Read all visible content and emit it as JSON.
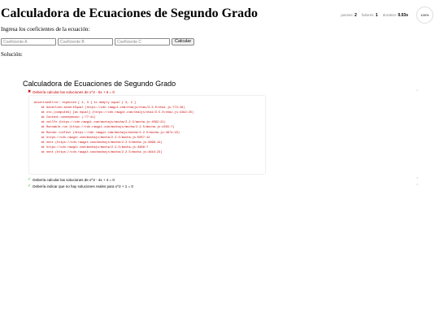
{
  "app": {
    "title": "Calculadora de Ecuaciones de Segundo Grado",
    "instructions": "Ingresa los coeficientes de la ecuación:",
    "inputs": [
      {
        "placeholder": "Coeficiente A",
        "value": ""
      },
      {
        "placeholder": "Coeficiente B",
        "value": ""
      },
      {
        "placeholder": "Coeficiente C",
        "value": ""
      }
    ],
    "calculate_label": "Calcular",
    "solution_label": "Solución:"
  },
  "stats": {
    "passes_label": "passes:",
    "passes": "2",
    "failures_label": "failures:",
    "failures": "1",
    "duration_label": "duration:",
    "duration": "0.03s",
    "progress": "100%"
  },
  "suite": {
    "title": "Calculadora de Ecuaciones de Segundo Grado",
    "tests": [
      {
        "status": "fail",
        "mark": "✖",
        "title": "Debería calcular las soluciones de x^2 - 5x + 6 = 0"
      },
      {
        "status": "pass",
        "mark": "✓",
        "title": "Debería calcular las soluciones de x^2 - 4x + 4 = 0"
      },
      {
        "status": "pass",
        "mark": "✓",
        "title": "Debería indicar que no hay soluciones reales para x^2 + 1 = 0"
      }
    ],
    "replay_glyph": "‣",
    "error_lines": [
      "AssertionError: expected [ 2, 3 ] to deeply equal [ 3, 2 ]",
      "    at Assertion.assertEqual (https://cdn.rawgit.com/chaijs/chai/3.5.0/chai.js:774:19)",
      "    at ctx.(computed) [as equal] (https://cdn.rawgit.com/chaijs/chai/3.5.0/chai.js:4192:25)",
      "    at Context.<anonymous> (:77:41)",
      "    at callFn (https://cdn.rawgit.com/mochajs/mocha/2.2.5/mocha.js:4582:21)",
      "    at Runnable.run (https://cdn.rawgit.com/mochajs/mocha/2.2.5/mocha.js:4555:7)",
      "    at Runner.runTest (https://cdn.rawgit.com/mochajs/mocha/2.2.5/mocha.js:4974:10)",
      "    at https://cdn.rawgit.com/mochajs/mocha/2.2.5/mocha.js:5057:12",
      "    at next (https://cdn.rawgit.com/mochajs/mocha/2.2.5/mocha.js:4899:14)",
      "    at https://cdn.rawgit.com/mochajs/mocha/2.2.5/mocha.js:4909:7",
      "    at next (https://cdn.rawgit.com/mochajs/mocha/2.2.5/mocha.js:4844:23)"
    ]
  }
}
